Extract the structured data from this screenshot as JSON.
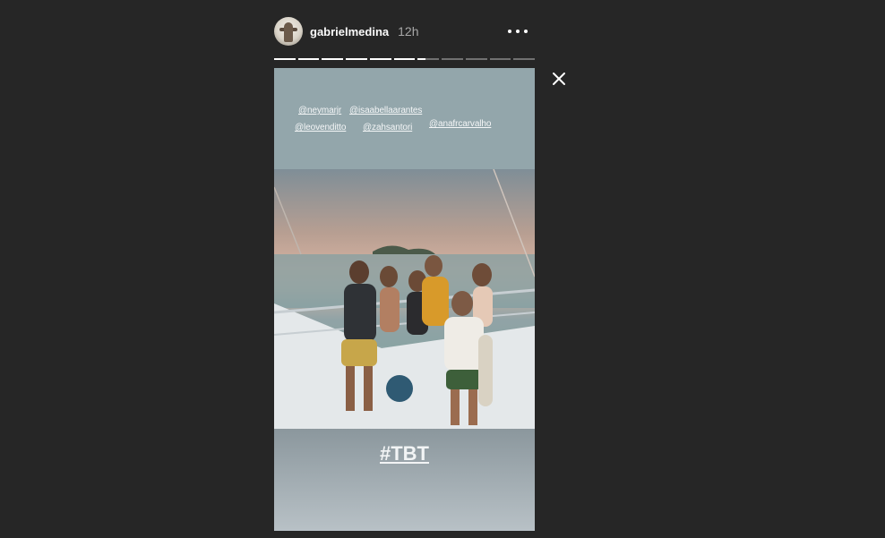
{
  "header": {
    "username": "gabrielmedina",
    "timestamp": "12h"
  },
  "progress": {
    "segment_count": 11,
    "completed_segments": 6,
    "current_segment_progress": 0.35
  },
  "story": {
    "mentions": [
      "@neymarjr",
      "@isaabellaarantes",
      "@leovenditto",
      "@zahsantori",
      "@anafrcarvalho"
    ],
    "hashtag": "#TBT"
  },
  "icons": {
    "more": "more-horizontal-icon",
    "close": "close-icon"
  },
  "colors": {
    "background": "#262626",
    "text_primary": "#fafafa",
    "text_secondary": "#a8a8a8"
  }
}
